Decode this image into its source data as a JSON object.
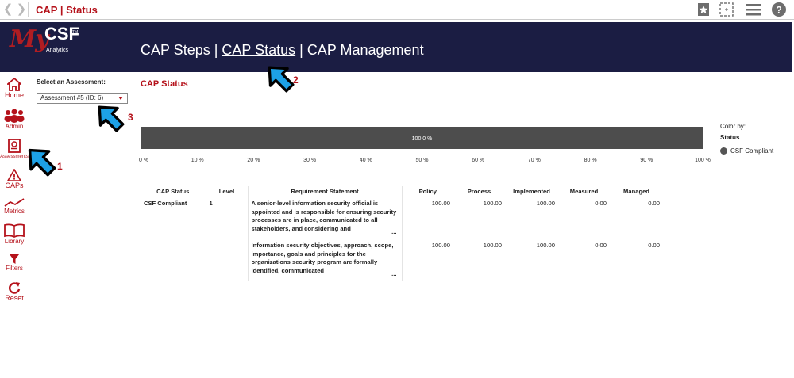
{
  "topbar": {
    "title": "CAP | Status",
    "back_icon": "chevron-left-icon",
    "forward_icon": "chevron-right-icon",
    "bookmark_icon": "star-bookmark-icon",
    "selection_icon": "dashed-selection-icon",
    "menu_icon": "hamburger-menu-icon",
    "help_icon": "help-circle-icon"
  },
  "banner": {
    "logo_my": "My",
    "logo_csf": "CSF",
    "logo_tm": "TM",
    "logo_analytics": "Analytics",
    "nav": {
      "steps": "CAP Steps",
      "sep1": " | ",
      "status": "CAP Status",
      "sep2": " | ",
      "management": "CAP Management"
    }
  },
  "sidebar": {
    "items": [
      {
        "label": "Home",
        "icon": "home-icon"
      },
      {
        "label": "Admin",
        "icon": "users-group-icon"
      },
      {
        "label": "Assessments",
        "icon": "assessment-document-icon"
      },
      {
        "label": "CAPs",
        "icon": "warning-triangle-icon"
      },
      {
        "label": "Metrics",
        "icon": "trend-line-icon"
      },
      {
        "label": "Library",
        "icon": "book-library-icon"
      },
      {
        "label": "Filters",
        "icon": "funnel-filter-icon"
      },
      {
        "label": "Reset",
        "icon": "reset-arrow-icon"
      }
    ]
  },
  "assessment": {
    "label": "Select an Assessment:",
    "selected": "Assessment #5 (ID: 6)"
  },
  "section_title": "CAP Status",
  "legend": {
    "title": "Color by:",
    "subtitle": "Status",
    "items": [
      {
        "label": "CSF Compliant",
        "color": "#555555"
      }
    ]
  },
  "chart_data": {
    "type": "bar",
    "orientation": "horizontal",
    "stacked_percent": true,
    "series": [
      {
        "name": "CSF Compliant",
        "values": [
          100.0
        ],
        "color": "#4d4d4d"
      }
    ],
    "bar_label": "100.0 %",
    "xlim": [
      0,
      100
    ],
    "x_ticks": [
      "0 %",
      "10 %",
      "20 %",
      "30 %",
      "40 %",
      "50 %",
      "60 %",
      "70 %",
      "80 %",
      "90 %",
      "100 %"
    ],
    "grid": false,
    "legend_position": "right"
  },
  "table": {
    "headers": [
      "CAP Status",
      "Level",
      "Requirement Statement",
      "Policy",
      "Process",
      "Implemented",
      "Measured",
      "Managed"
    ],
    "group": {
      "status": "CSF Compliant",
      "level": "1"
    },
    "rows": [
      {
        "requirement": "A senior-level information security official is appointed and is responsible for ensuring security processes are in place, communicated to all stakeholders, and considering and",
        "policy": "100.00",
        "process": "100.00",
        "implemented": "100.00",
        "measured": "0.00",
        "managed": "0.00"
      },
      {
        "requirement": "Information security objectives, approach, scope, importance, goals and principles for the organizations security program are formally identified, communicated",
        "policy": "100.00",
        "process": "100.00",
        "implemented": "100.00",
        "measured": "0.00",
        "managed": "0.00"
      }
    ],
    "ellipsis": "..."
  },
  "annotations": {
    "arrow_color": "#1da1e6",
    "labels": [
      "1",
      "2",
      "3"
    ]
  }
}
